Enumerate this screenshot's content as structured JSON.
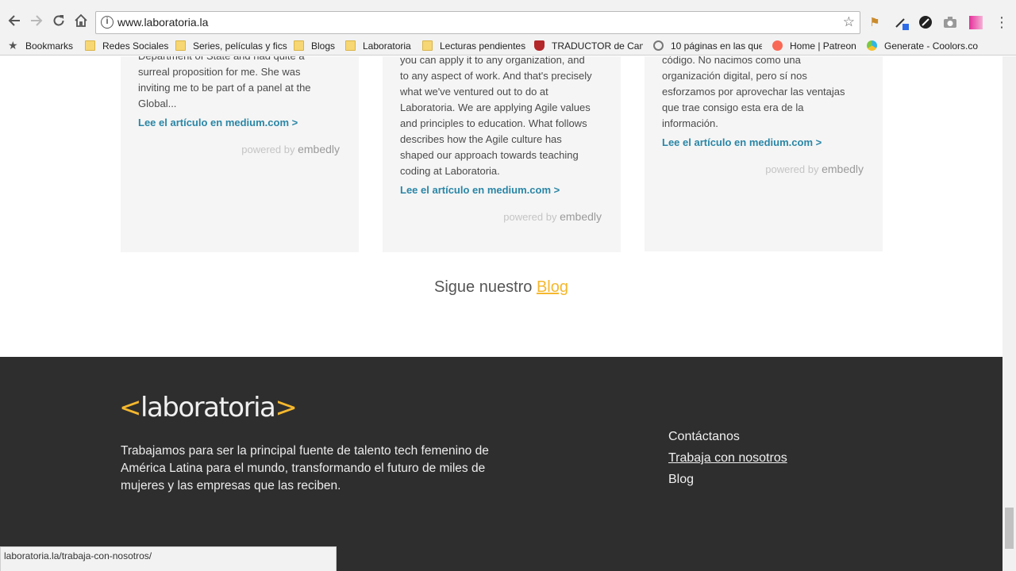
{
  "browser": {
    "url": "www.laboratoria.la",
    "bookmarks": [
      {
        "label": "Bookmarks",
        "icon": "star-icon"
      },
      {
        "label": "Redes Sociales",
        "icon": "folder-icon"
      },
      {
        "label": "Series, películas y fics",
        "icon": "folder-icon"
      },
      {
        "label": "Blogs",
        "icon": "folder-icon"
      },
      {
        "label": "Laboratoria",
        "icon": "folder-icon"
      },
      {
        "label": "Lecturas pendientes",
        "icon": "folder-icon"
      },
      {
        "label": "TRADUCTOR de Cam",
        "icon": "crest-icon"
      },
      {
        "label": "10 páginas en las que",
        "icon": "ring-icon"
      },
      {
        "label": "Home | Patreon",
        "icon": "patreon-icon"
      },
      {
        "label": "Generate - Coolors.co",
        "icon": "coolors-icon"
      }
    ],
    "status_url": "laboratoria.la/trabaja-con-nosotros/"
  },
  "cards": [
    {
      "text_lines": [
        "Department of State and had quite a",
        "surreal proposition for me. She was",
        "inviting me to be part of a panel at the",
        "Global..."
      ],
      "link": "Lee el artículo en medium.com >",
      "powered_prefix": "powered by",
      "powered_brand": "embedly"
    },
    {
      "text_lines": [
        "you can apply it to any organization, and",
        "to any aspect of work. And that's precisely",
        "what we've ventured out to do at",
        "Laboratoria. We are applying Agile values",
        "and principles to education. What follows",
        "describes how the Agile culture has",
        "shaped our approach towards teaching",
        "coding at Laboratoria."
      ],
      "link": "Lee el artículo en medium.com >",
      "powered_prefix": "powered by",
      "powered_brand": "embedly"
    },
    {
      "text_lines": [
        "código. No nacimos como una",
        "organización digital, pero sí nos",
        "esforzamos por aprovechar las ventajas",
        "que trae consigo esta era de la",
        "información."
      ],
      "link": "Lee el artículo en medium.com >",
      "powered_prefix": "powered by",
      "powered_brand": "embedly"
    }
  ],
  "follow": {
    "prefix": "Sigue nuestro",
    "link": "Blog"
  },
  "footer": {
    "logo_open": "<",
    "logo_text": "laboratoria",
    "logo_close": ">",
    "mission_lines": [
      "Trabajamos para ser la principal fuente de talento tech femenino de",
      "América Latina para el mundo, transformando el futuro de miles de",
      "mujeres y las empresas que las reciben."
    ],
    "links": [
      "Contáctanos",
      "Trabaja con nosotros",
      "Blog"
    ]
  },
  "colors": {
    "accent": "#f5b82e",
    "link": "#2a86a6",
    "footer_bg": "#2f2e2e",
    "card_bg": "#f5f5f5"
  }
}
